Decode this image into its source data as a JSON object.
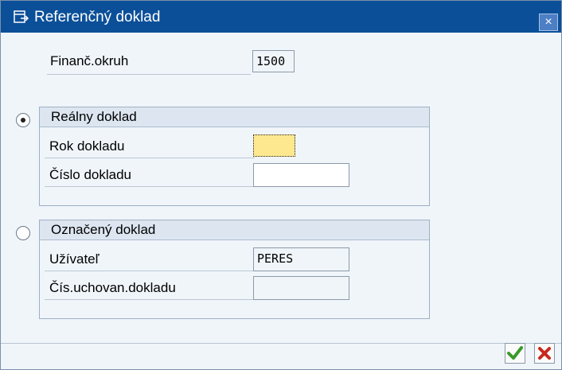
{
  "window": {
    "title": "Referenčný doklad",
    "close_label": "×"
  },
  "form": {
    "company_code": {
      "label": "Finanč.okruh",
      "value": "1500"
    }
  },
  "group_real": {
    "title": "Reálny doklad",
    "selected": true,
    "fields": [
      {
        "label": "Rok dokladu",
        "value": ""
      },
      {
        "label": "Číslo dokladu",
        "value": ""
      }
    ]
  },
  "group_marked": {
    "title": "Označený doklad",
    "selected": false,
    "fields": [
      {
        "label": "Užívateľ",
        "value": "PERES"
      },
      {
        "label": "Čís.uchovan.dokladu",
        "value": ""
      }
    ]
  },
  "footer": {
    "confirm_icon": "checkmark-icon",
    "cancel_icon": "cancel-x-icon"
  },
  "colors": {
    "title_bar": "#0b4f99",
    "confirm_green": "#3a9a2a",
    "cancel_red": "#c8281e",
    "input_focus": "#fde890"
  }
}
